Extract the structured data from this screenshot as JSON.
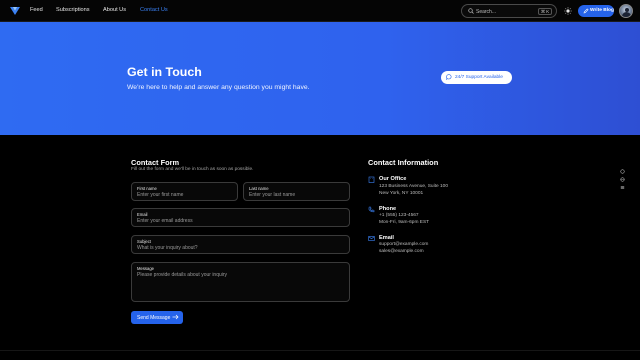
{
  "nav": {
    "links": [
      "Feed",
      "Subscriptions",
      "About Us",
      "Contact Us"
    ],
    "active_index": 3,
    "search_placeholder": "Search...",
    "search_shortcut": "⌘ K",
    "write_button": "Write Blog",
    "accent_color": "#2563eb"
  },
  "hero": {
    "title": "Get in Touch",
    "subtitle": "We're here to help and answer any question you might have.",
    "badge": "24/7 Support Available",
    "gradient": [
      "#2f6bf2",
      "#2e4fd3"
    ]
  },
  "form": {
    "title": "Contact Form",
    "subtitle": "Fill out the form and we'll be in touch as soon as possible.",
    "fields": {
      "first_name": {
        "label": "First name",
        "placeholder": "Enter your first name"
      },
      "last_name": {
        "label": "Last name",
        "placeholder": "Enter your last name"
      },
      "email": {
        "label": "Email",
        "placeholder": "Enter your email address"
      },
      "subject": {
        "label": "Subject",
        "placeholder": "What is your inquiry about?"
      },
      "message": {
        "label": "Message",
        "placeholder": "Please provide details about your inquiry"
      }
    },
    "submit": "Send Message"
  },
  "info": {
    "title": "Contact Information",
    "office": {
      "title": "Our Office",
      "lines": [
        "123 Business Avenue, Suite 100",
        "New York, NY 10001"
      ]
    },
    "phone": {
      "title": "Phone",
      "lines": [
        "+1 (555) 123-4567",
        "Mon-Fri, 9am-6pm EST"
      ]
    },
    "email": {
      "title": "Email",
      "lines": [
        "support@example.com",
        "sales@example.com"
      ]
    },
    "icon_color": "#3b82f6"
  },
  "icons": [
    "logo-icon",
    "search-icon",
    "sun-icon",
    "pencil-icon",
    "chat-bubble-icon",
    "arrow-right-icon",
    "building-icon",
    "phone-icon",
    "mail-icon",
    "circle-icon",
    "globe-icon",
    "list-icon"
  ]
}
